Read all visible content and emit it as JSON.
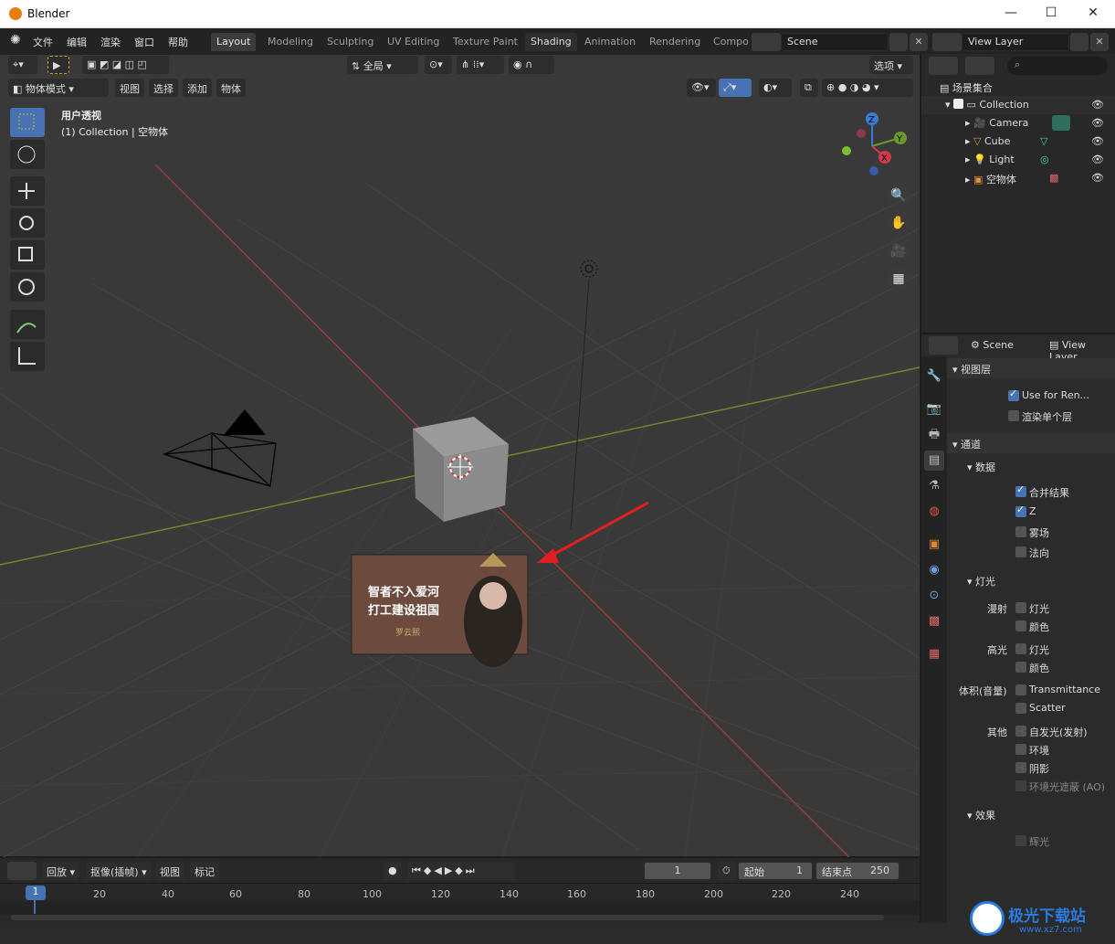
{
  "window": {
    "title": "Blender",
    "minimize": "—",
    "maximize": "☐",
    "close": "✕"
  },
  "menubar": {
    "menus": [
      "文件",
      "编辑",
      "渲染",
      "窗口",
      "帮助"
    ],
    "workspaces": [
      "Layout",
      "Modeling",
      "Sculpting",
      "UV Editing",
      "Texture Paint",
      "Shading",
      "Animation",
      "Rendering",
      "Compo"
    ],
    "active_workspace": "Layout",
    "scene": "Scene",
    "view_layer": "View Layer"
  },
  "viewport": {
    "transform_orientation": "全局",
    "options_label": "选项",
    "mode": "物体模式",
    "menus": [
      "视图",
      "选择",
      "添加",
      "物体"
    ],
    "view_name": "用户透视",
    "context": "(1) Collection | 空物体",
    "image_caption_line1": "智者不入爱河",
    "image_caption_line2": "打工建设祖国",
    "image_caption_small": "罗云熙"
  },
  "outliner": {
    "root": "场景集合",
    "items": [
      {
        "label": "Collection"
      },
      {
        "label": "Camera"
      },
      {
        "label": "Cube"
      },
      {
        "label": "Light"
      },
      {
        "label": "空物体"
      }
    ]
  },
  "properties": {
    "scene_tab": "Scene",
    "view_layer_tab": "View Layer",
    "section_view_layer": "视图层",
    "use_for_render": "Use for Ren...",
    "render_single_layer": "渲染单个层",
    "section_passes": "通道",
    "sub_data": "数据",
    "data_items": [
      "合并结果",
      "Z",
      "雾场",
      "法向"
    ],
    "sub_light": "灯光",
    "diffuse_label": "漫射",
    "diffuse_items": [
      "灯光",
      "颜色"
    ],
    "glossy_label": "高光",
    "glossy_items": [
      "灯光",
      "颜色"
    ],
    "volume_label": "体积(音量)",
    "volume_items": [
      "Transmittance",
      "Scatter"
    ],
    "other_label": "其他",
    "other_items": [
      "自发光(发射)",
      "环境",
      "阴影",
      "环境光遮蔽 (AO)"
    ],
    "sub_effects": "效果",
    "effects_items": [
      "辉光"
    ]
  },
  "timeline": {
    "playback": "回放",
    "keying": "抠像(插帧)",
    "view": "视图",
    "marker": "标记",
    "current_frame": "1",
    "start_label": "起始",
    "start_value": "1",
    "end_label": "结束点",
    "end_value": "250",
    "ruler": [
      "1",
      "20",
      "40",
      "60",
      "80",
      "100",
      "120",
      "140",
      "160",
      "180",
      "200",
      "220",
      "240"
    ]
  },
  "watermark": {
    "name": "极光下载站",
    "url": "www.xz7.com"
  }
}
